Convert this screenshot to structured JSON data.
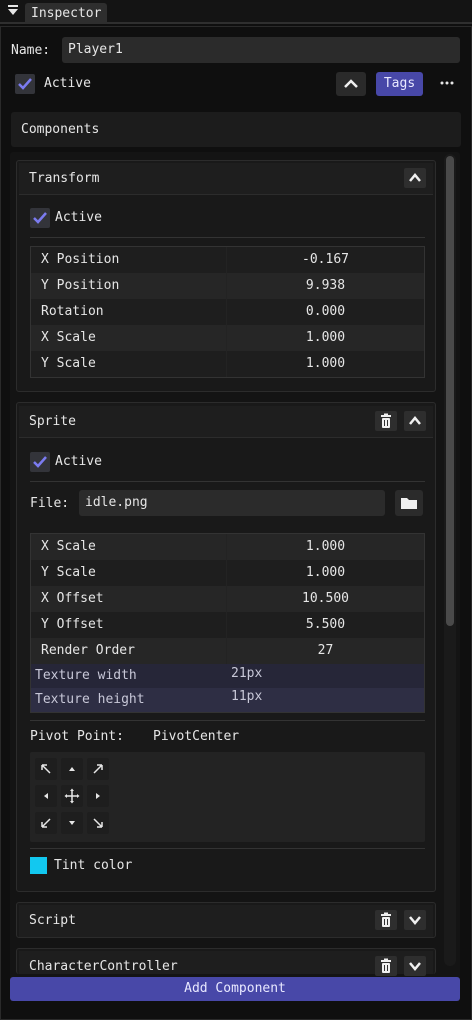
{
  "window": {
    "tab_title": "Inspector"
  },
  "entity": {
    "name_label": "Name:",
    "name_value": "Player1",
    "active_label": "Active",
    "tags_label": "Tags",
    "more_label": "···"
  },
  "components": {
    "header": "Components",
    "add_label": "Add Component"
  },
  "transform": {
    "title": "Transform",
    "active_label": "Active",
    "rows": [
      {
        "key": "X Position",
        "value": "-0.167"
      },
      {
        "key": "Y Position",
        "value": "9.938"
      },
      {
        "key": "Rotation",
        "value": "0.000"
      },
      {
        "key": "X Scale",
        "value": "1.000"
      },
      {
        "key": "Y Scale",
        "value": "1.000"
      }
    ]
  },
  "sprite": {
    "title": "Sprite",
    "active_label": "Active",
    "file_label": "File:",
    "file_value": "idle.png",
    "rows": [
      {
        "key": "X Scale",
        "value": "1.000"
      },
      {
        "key": "Y Scale",
        "value": "1.000"
      },
      {
        "key": "X Offset",
        "value": "10.500"
      },
      {
        "key": "Y Offset",
        "value": "5.500"
      },
      {
        "key": "Render Order",
        "value": "27"
      }
    ],
    "info_rows": [
      {
        "key": "Texture width",
        "value": "21px"
      },
      {
        "key": "Texture height",
        "value": "11px"
      }
    ],
    "pivot_label": "Pivot Point:",
    "pivot_value": "PivotCenter",
    "tint_label": "Tint color",
    "tint_color": "#12c8f0"
  },
  "script": {
    "title": "Script"
  },
  "character_controller": {
    "title": "CharacterController"
  },
  "colors": {
    "accent": "#4848a8",
    "check": "#7b7bf0"
  }
}
